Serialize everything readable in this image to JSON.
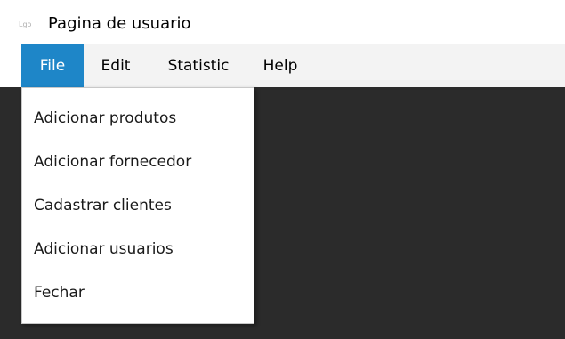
{
  "window": {
    "title": "Pagina de usuario",
    "icon": "app-logo-icon"
  },
  "menubar": {
    "items": [
      {
        "label": "File",
        "active": true
      },
      {
        "label": "Edit",
        "active": false
      },
      {
        "label": "Statistic",
        "active": false
      },
      {
        "label": "Help",
        "active": false
      }
    ]
  },
  "file_menu": {
    "items": [
      {
        "label": "Adicionar produtos"
      },
      {
        "label": "Adicionar fornecedor"
      },
      {
        "label": "Cadastrar clientes"
      },
      {
        "label": "Adicionar usuarios"
      },
      {
        "label": "Fechar"
      }
    ]
  },
  "colors": {
    "accent": "#1e86c8",
    "menubar_bg": "#f3f3f3",
    "content_bg": "#2b2b2b"
  }
}
